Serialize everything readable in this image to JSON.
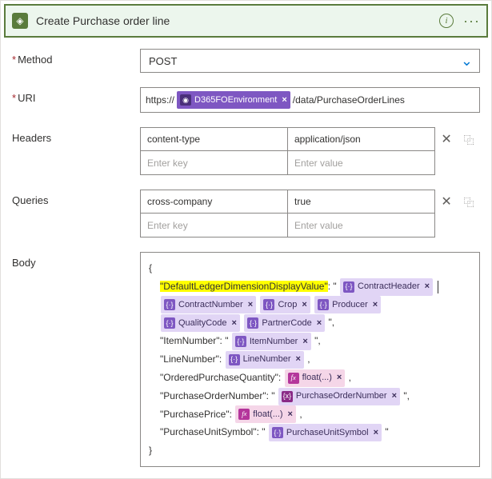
{
  "header": {
    "title": "Create Purchase order line"
  },
  "labels": {
    "method": "Method",
    "uri": "URI",
    "headers": "Headers",
    "queries": "Queries",
    "body": "Body",
    "asterisk": "*"
  },
  "method": {
    "value": "POST"
  },
  "uri": {
    "prefix": "https://",
    "token": "D365FOEnvironment",
    "suffix": "/data/PurchaseOrderLines"
  },
  "headers": {
    "rows": [
      {
        "key": "content-type",
        "value": "application/json"
      }
    ],
    "placeholder_key": "Enter key",
    "placeholder_value": "Enter value"
  },
  "queries": {
    "rows": [
      {
        "key": "cross-company",
        "value": "true"
      }
    ],
    "placeholder_key": "Enter key",
    "placeholder_value": "Enter value"
  },
  "payload": {
    "open": "{",
    "close": "}",
    "keys": {
      "dldv": "\"DefaultLedgerDimensionDisplayValue\"",
      "item": "ItemNumber",
      "line": "LineNumber",
      "qty": "OrderedPurchaseQuantity",
      "po": "PurchaseOrderNumber",
      "price": "PurchasePrice",
      "unit": "PurchaseUnitSymbol"
    },
    "tokens": {
      "contractHeader": "ContractHeader",
      "contractNumber": "ContractNumber",
      "crop": "Crop",
      "producer": "Producer",
      "qualityCode": "QualityCode",
      "partnerCode": "PartnerCode",
      "itemNumber": "ItemNumber",
      "lineNumber": "LineNumber",
      "float": "float(...)",
      "purchaseOrderNumber": "PurchaseOrderNumber",
      "purchaseUnitSymbol": "PurchaseUnitSymbol"
    }
  }
}
